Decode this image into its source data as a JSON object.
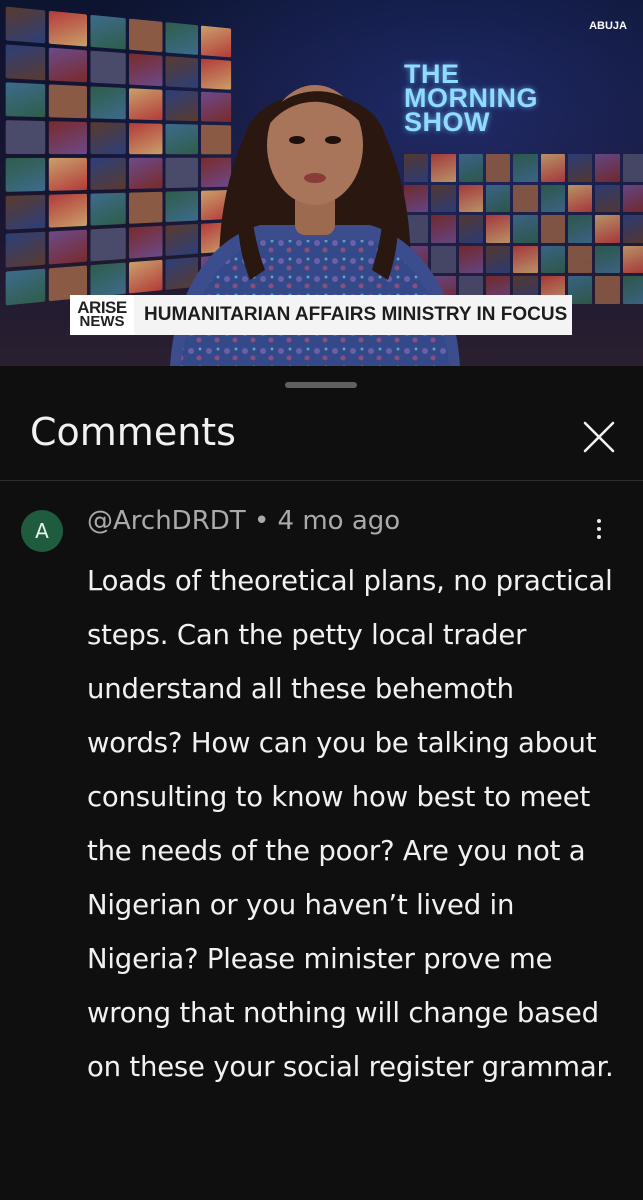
{
  "video": {
    "location": "ABUJA",
    "show_logo_lines": [
      "THE",
      "MORNING",
      "SHOW"
    ],
    "brand_line1": "ARISE",
    "brand_line2": "NEWS",
    "headline": "HUMANITARIAN AFFAIRS MINISTRY IN FOCUS"
  },
  "sheet": {
    "title": "Comments"
  },
  "comment": {
    "avatar_letter": "A",
    "handle": "@ArchDRDT",
    "separator": "•",
    "age": "4 mo ago",
    "text": "Loads of theoretical plans, no practical steps. Can the petty local trader understand all these behemoth words? How can you be talking about consulting to know how best to meet the needs of the poor? Are you not a Nigerian or you haven’t lived in Nigeria? Please minister prove me wrong that nothing will change based on these your social register grammar."
  },
  "colors": {
    "background": "#0f0f0f",
    "avatar": "#1f5b3d",
    "show_logo": "#8fdcff"
  },
  "icons": {
    "close": "close-icon",
    "more": "more-vert-icon"
  }
}
